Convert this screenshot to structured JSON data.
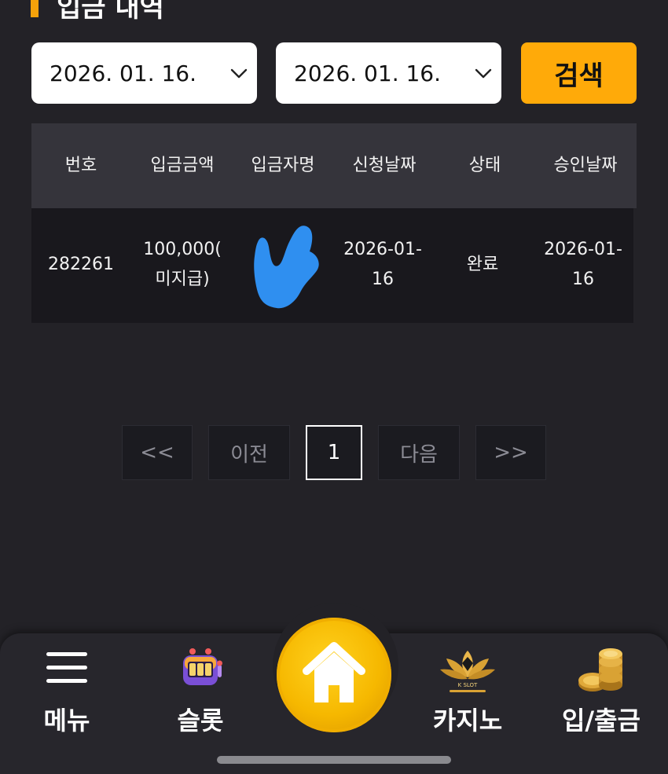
{
  "page_title": "입금 내역",
  "filters": {
    "start_date": "2026. 01. 16.",
    "end_date": "2026. 01. 16.",
    "search_label": "검색"
  },
  "table": {
    "columns": [
      "번호",
      "입금금액",
      "입금자명",
      "신청날짜",
      "상태",
      "승인날짜"
    ],
    "rows": [
      {
        "number": "282261",
        "amount_line1": "100,000(",
        "amount_line2": "미지급)",
        "depositor": "",
        "request_line1": "2026-01-",
        "request_line2": "16",
        "status": "완료",
        "approve_line1": "2026-01-",
        "approve_line2": "16"
      }
    ]
  },
  "pagination": {
    "first": "<<",
    "prev": "이전",
    "current": "1",
    "next": "다음",
    "last": ">>"
  },
  "bottom_nav": {
    "menu": "메뉴",
    "slot": "슬롯",
    "casino": "카지노",
    "deposit": "입/출금",
    "casino_logo_text": "K SLOT"
  },
  "colors": {
    "accent": "#ffaa09",
    "background": "#232227",
    "home_button": "#f6b800",
    "blur_mark": "#2f8ff0"
  }
}
